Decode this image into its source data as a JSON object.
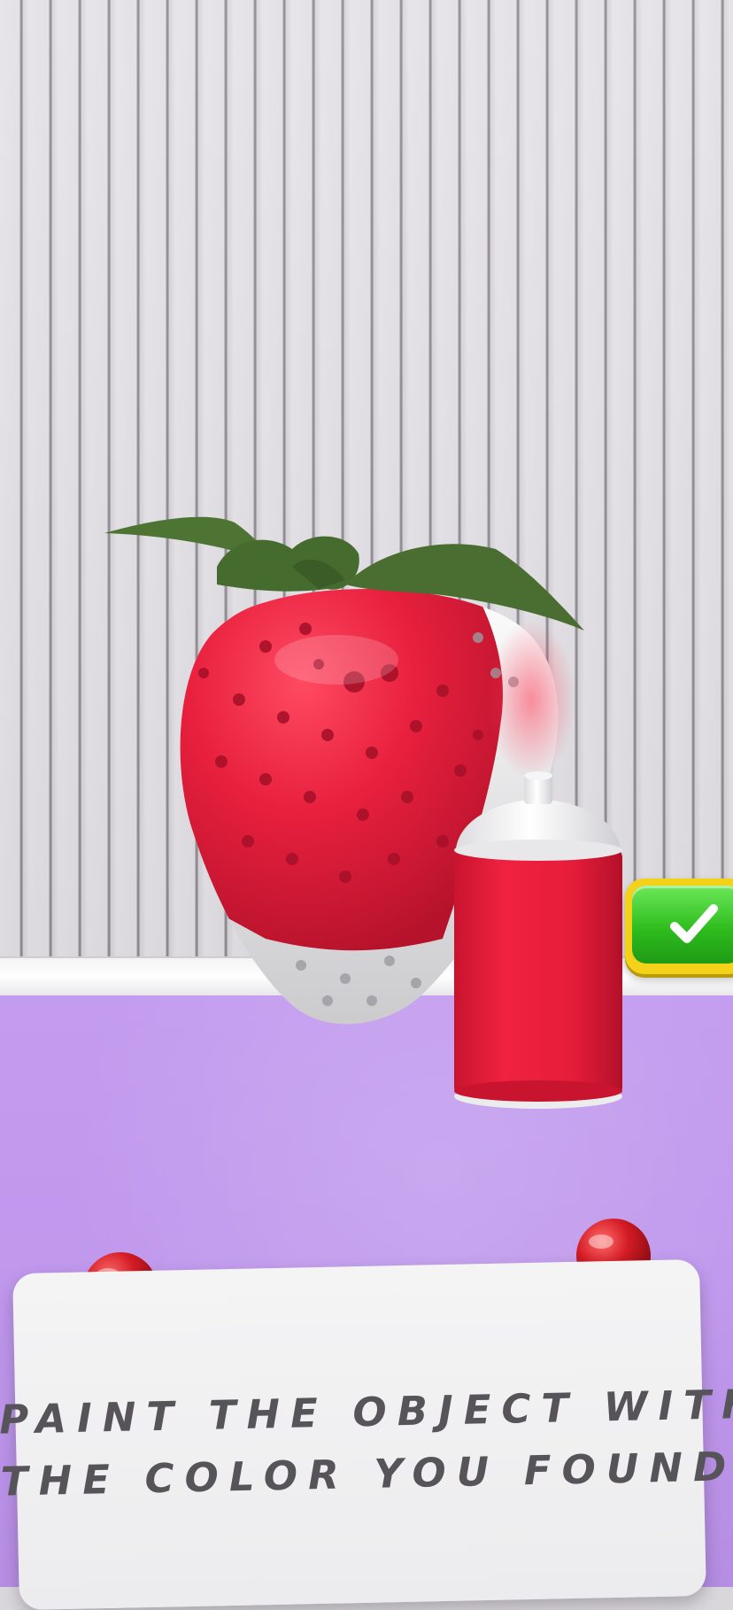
{
  "instruction": {
    "line1": "PAINT THE OBJECT WITH",
    "line2": "THE COLOR YOU FOUND"
  },
  "confirm_button": {
    "icon": "checkmark-icon"
  },
  "colors": {
    "paint": "#e8203e",
    "leaf": "#4a6e31",
    "table": "#c39cef",
    "wall": "#e6e4e8",
    "button_green": "#2fbd1f",
    "button_border": "#f4d21a",
    "pin": "#d41b24"
  }
}
